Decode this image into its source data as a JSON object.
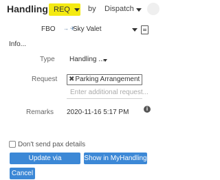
{
  "header": {
    "title": "Handling",
    "type_selected": "REQ",
    "by_label": "by",
    "assignee_selected": "Dispatch"
  },
  "fbo": {
    "label": "FBO",
    "icons": "→ ✈",
    "value": "Sky Valet"
  },
  "info_link": "Info...",
  "type": {
    "label": "Type",
    "value": "Handling ..."
  },
  "request": {
    "label": "Request",
    "chip_remove": "✖",
    "chip_label": "Parking Arrangement",
    "placeholder": "Enter additional request..."
  },
  "remarks": {
    "label": "Remarks",
    "value": "2020-11-16 5:17 PM",
    "info_icon_glyph": "i"
  },
  "pax": {
    "label": "Don't send pax details",
    "checked": false
  },
  "buttons": {
    "update": "Update via MyHandling",
    "show": "Show in MyHandling",
    "cancel": "Cancel"
  },
  "colors": {
    "req_highlight": "#f4ea12",
    "button_blue": "#3c88d6"
  }
}
